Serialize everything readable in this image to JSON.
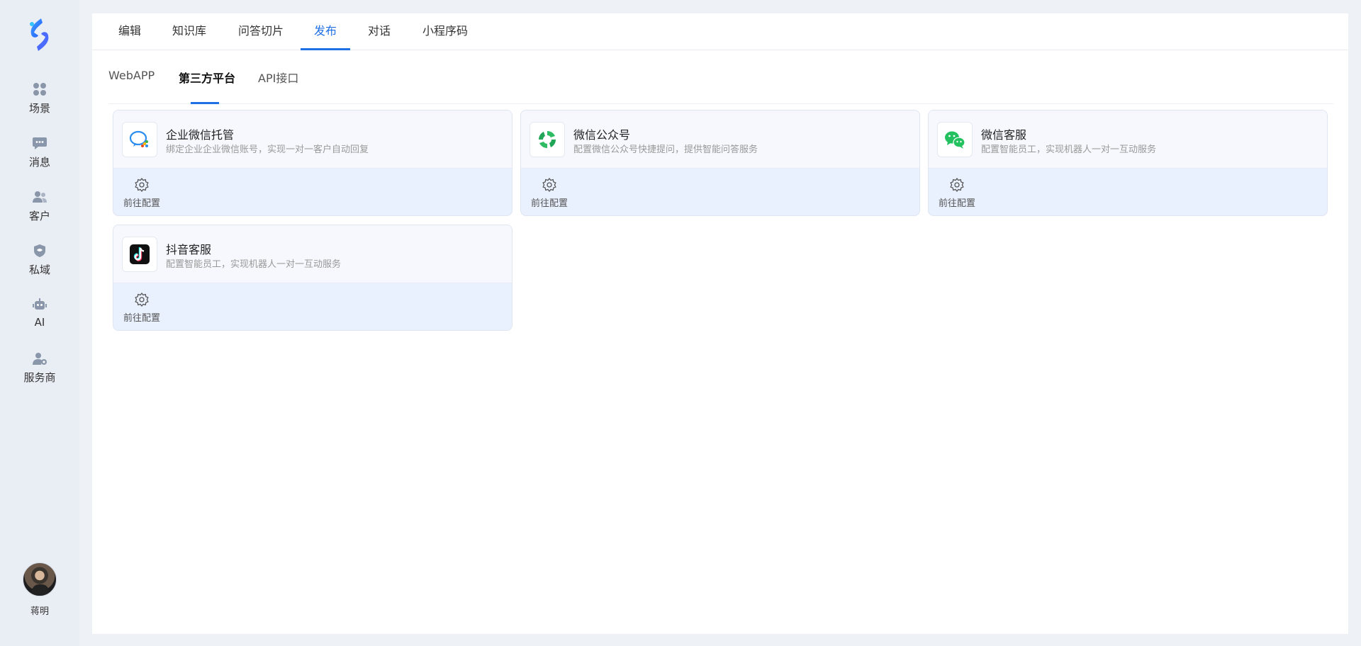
{
  "sidebar": {
    "items": [
      {
        "label": "场景",
        "icon": "grid-icon"
      },
      {
        "label": "消息",
        "icon": "chat-icon"
      },
      {
        "label": "客户",
        "icon": "users-icon"
      },
      {
        "label": "私域",
        "icon": "shield-icon"
      },
      {
        "label": "AI",
        "icon": "robot-icon"
      },
      {
        "label": "服务商",
        "icon": "user-gear-icon"
      }
    ],
    "user": {
      "name": "蒋明"
    }
  },
  "tabs": [
    {
      "label": "编辑"
    },
    {
      "label": "知识库"
    },
    {
      "label": "问答切片"
    },
    {
      "label": "发布",
      "active": true
    },
    {
      "label": "对话"
    },
    {
      "label": "小程序码"
    }
  ],
  "subtabs": [
    {
      "label": "WebAPP"
    },
    {
      "label": "第三方平台",
      "active": true
    },
    {
      "label": "API接口"
    }
  ],
  "cards": [
    {
      "title": "企业微信托管",
      "desc": "绑定企业企业微信账号，实现一对一客户自动回复",
      "action": "前往配置",
      "icon": "wecom-icon"
    },
    {
      "title": "微信公众号",
      "desc": "配置微信公众号快捷提问，提供智能问答服务",
      "action": "前往配置",
      "icon": "wechat-official-icon"
    },
    {
      "title": "微信客服",
      "desc": "配置智能员工，实现机器人一对一互动服务",
      "action": "前往配置",
      "icon": "wechat-icon"
    },
    {
      "title": "抖音客服",
      "desc": "配置智能员工，实现机器人一对一互动服务",
      "action": "前往配置",
      "icon": "douyin-icon"
    }
  ],
  "colors": {
    "accent": "#1f6fe5",
    "card_bg": "#e9f0fe",
    "sidebar_bg": "#e9edf4"
  }
}
